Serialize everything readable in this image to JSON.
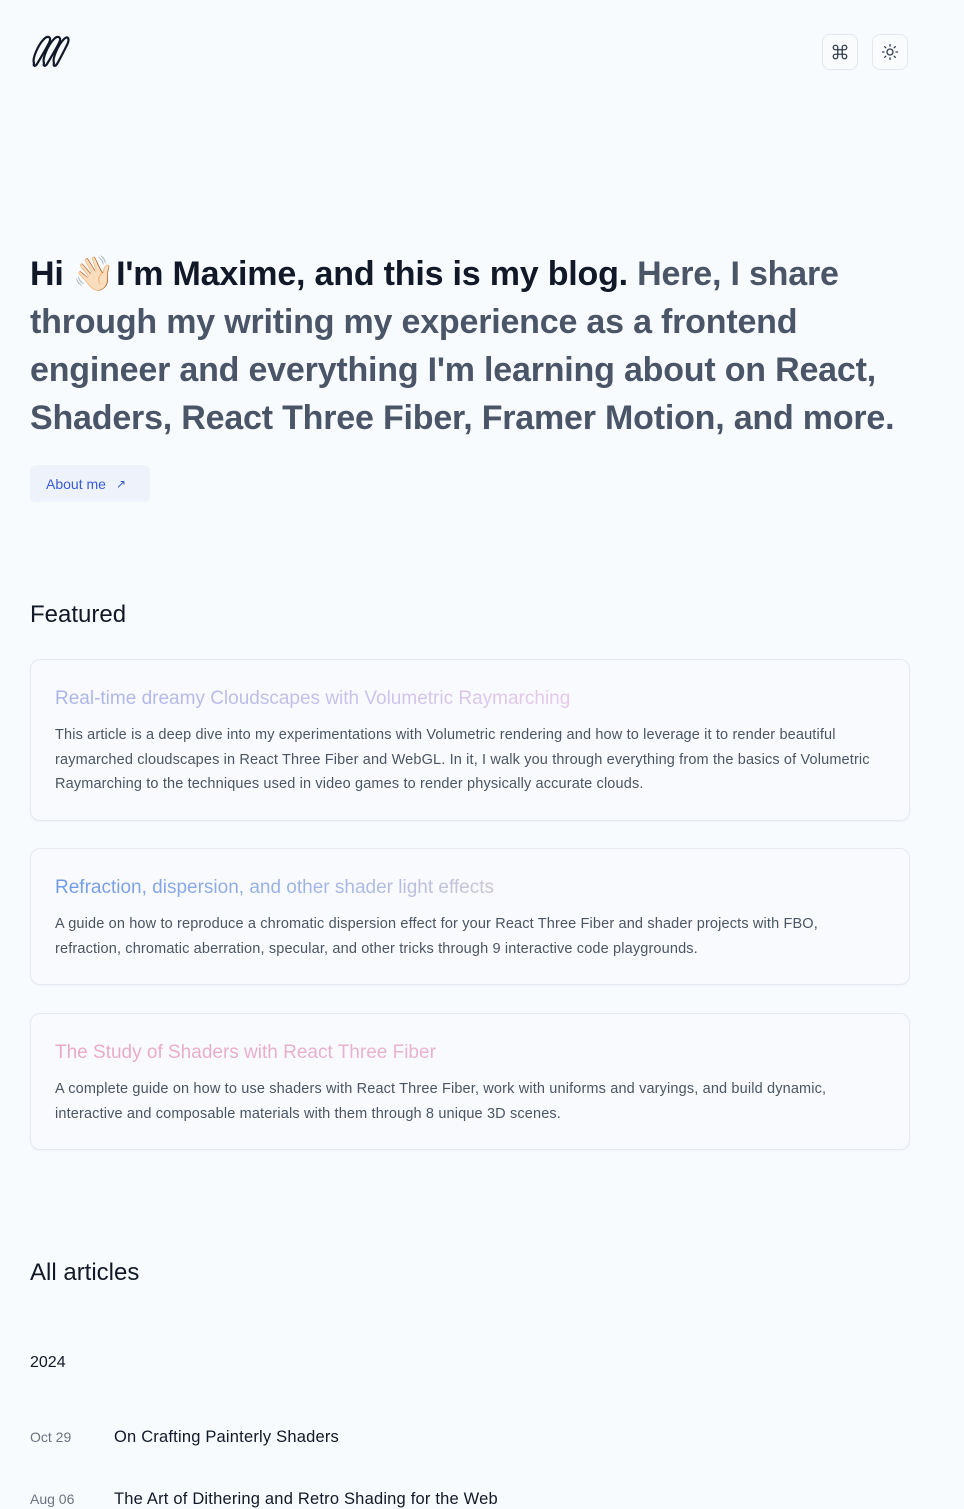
{
  "header": {
    "logo_icon": "maxime-logo-icon",
    "command_icon": "command-icon",
    "theme_icon": "sun-icon"
  },
  "hero": {
    "greeting": "Hi",
    "wave_emoji": "👋🏻",
    "intro": "I'm Maxime, and this is my blog.",
    "rest": "Here, I share through my writing my experience as a frontend engineer and everything I'm learning about on React, Shaders, React Three Fiber, Framer Motion, and more."
  },
  "about_button": {
    "label": "About me",
    "icon": "arrow-up-right-icon",
    "glyph": "↗"
  },
  "featured": {
    "title": "Featured",
    "items": [
      {
        "title": "Real-time dreamy Cloudscapes with Volumetric Raymarching",
        "description": "This article is a deep dive into my experimentations with Volumetric rendering and how to leverage it to render beautiful raymarched cloudscapes in React Three Fiber and WebGL. In it, I walk you through everything from the basics of Volumetric Raymarching to the techniques used in video games to render physically accurate clouds."
      },
      {
        "title": "Refraction, dispersion, and other shader light effects",
        "description": "A guide on how to reproduce a chromatic dispersion effect for your React Three Fiber and shader projects with FBO, refraction, chromatic aberration, specular, and other tricks through 9 interactive code playgrounds."
      },
      {
        "title": "The Study of Shaders with React Three Fiber",
        "description": "A complete guide on how to use shaders with React Three Fiber, work with uniforms and varyings, and build dynamic, interactive and composable materials with them through 8 unique 3D scenes."
      }
    ]
  },
  "articles": {
    "title": "All articles",
    "year": "2024",
    "items": [
      {
        "date": "Oct 29",
        "title": "On Crafting Painterly Shaders"
      },
      {
        "date": "Aug 06",
        "title": "The Art of Dithering and Retro Shading for the Web"
      }
    ]
  }
}
